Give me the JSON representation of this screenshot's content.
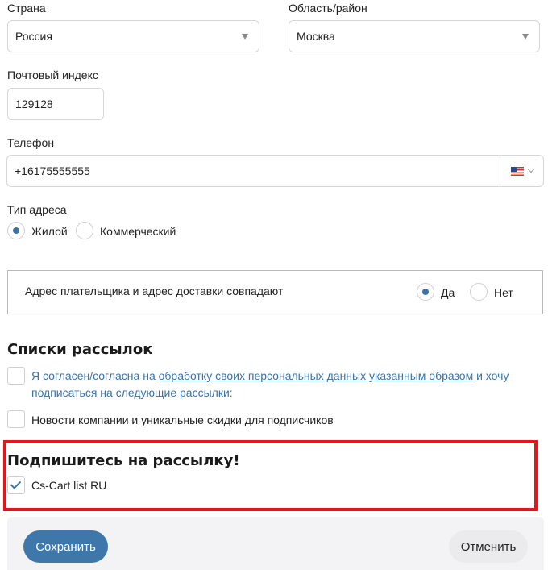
{
  "address": {
    "country_label": "Страна",
    "country_value": "Россия",
    "region_label": "Область/район",
    "region_value": "Москва",
    "zip_label": "Почтовый индекс",
    "zip_value": "129128",
    "phone_label": "Телефон",
    "phone_value": "+16175555555",
    "phone_country_icon": "us-flag-icon",
    "address_type_label": "Тип адреса",
    "address_type_options": [
      {
        "label": "Жилой",
        "checked": true
      },
      {
        "label": "Коммерческий",
        "checked": false
      }
    ]
  },
  "shipping_same": {
    "label": "Адрес плательщика и адрес доставки совпадают",
    "options": [
      {
        "label": "Да",
        "checked": true
      },
      {
        "label": "Нет",
        "checked": false
      }
    ]
  },
  "mailing": {
    "heading": "Списки рассылок",
    "consent_prefix": "Я согласен/согласна на ",
    "consent_link": "обработку своих персональных данных указанным образом",
    "consent_suffix": " и хочу подписаться на следующие рассылки:",
    "consent_checked": false,
    "newsletter_label": "Новости компании и уникальные скидки для подписчиков",
    "newsletter_checked": false
  },
  "subscribe": {
    "heading": "Подпишитесь на рассылку!",
    "list_label": "Cs-Cart list RU",
    "list_checked": true
  },
  "actions": {
    "save_label": "Сохранить",
    "cancel_label": "Отменить"
  },
  "colors": {
    "accent": "#3e78ab",
    "highlight": "#e8141c"
  }
}
